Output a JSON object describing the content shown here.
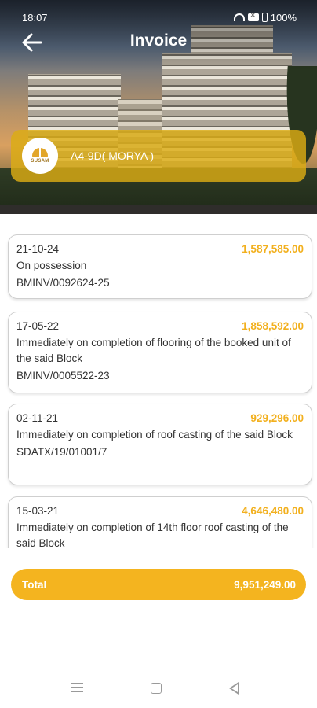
{
  "status_bar": {
    "time": "18:07",
    "battery": "100%"
  },
  "header": {
    "title": "Invoice",
    "back_icon": "arrow-left-icon"
  },
  "unit": {
    "name": "A4-9D( MORYA )",
    "logo_text": "SUSAM"
  },
  "invoices": [
    {
      "date": "21-10-24",
      "amount": "1,587,585.00",
      "description": "On possession",
      "reference": "BMINV/0092624-25"
    },
    {
      "date": "17-05-22",
      "amount": "1,858,592.00",
      "description": "Immediately on completion of flooring of the booked unit of the said Block",
      "reference": "BMINV/0005522-23"
    },
    {
      "date": "02-11-21",
      "amount": "929,296.00",
      "description": "Immediately on completion of roof casting of the said Block",
      "reference": "SDATX/19/01001/7"
    },
    {
      "date": "15-03-21",
      "amount": "4,646,480.00",
      "description": "Immediately on completion of 14th floor roof casting of the said Block",
      "reference": ""
    }
  ],
  "total": {
    "label": "Total",
    "amount": "9,951,249.00"
  },
  "colors": {
    "accent": "#F4B41F",
    "card_overlay": "#DCAC14",
    "amount_text": "#F2B01E"
  }
}
